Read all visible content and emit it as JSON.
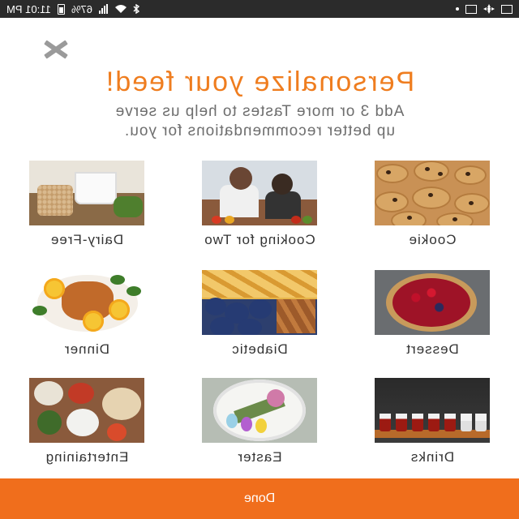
{
  "status_bar": {
    "time": "11:01 PM",
    "battery": "67%"
  },
  "header": {
    "title": "Personalize your feed!",
    "subtitle_line1": "Add 3 or more Tastes to help us serve",
    "subtitle_line2": "up better recommendations for you."
  },
  "tastes": [
    {
      "label": "Cookie",
      "image": "cookie"
    },
    {
      "label": "Cooking for Two",
      "image": "cooking-for-two"
    },
    {
      "label": "Dairy-Free",
      "image": "dairy-free"
    },
    {
      "label": "Dessert",
      "image": "dessert"
    },
    {
      "label": "Diabetic",
      "image": "diabetic"
    },
    {
      "label": "Dinner",
      "image": "dinner"
    },
    {
      "label": "Drinks",
      "image": "drinks"
    },
    {
      "label": "Easter",
      "image": "easter"
    },
    {
      "label": "Entertaining",
      "image": "entertaining"
    }
  ],
  "footer": {
    "done_label": "Done"
  },
  "colors": {
    "accent": "#ef7d1f",
    "done_bar": "#f06e1c",
    "status_bar": "#2b2b2b"
  }
}
